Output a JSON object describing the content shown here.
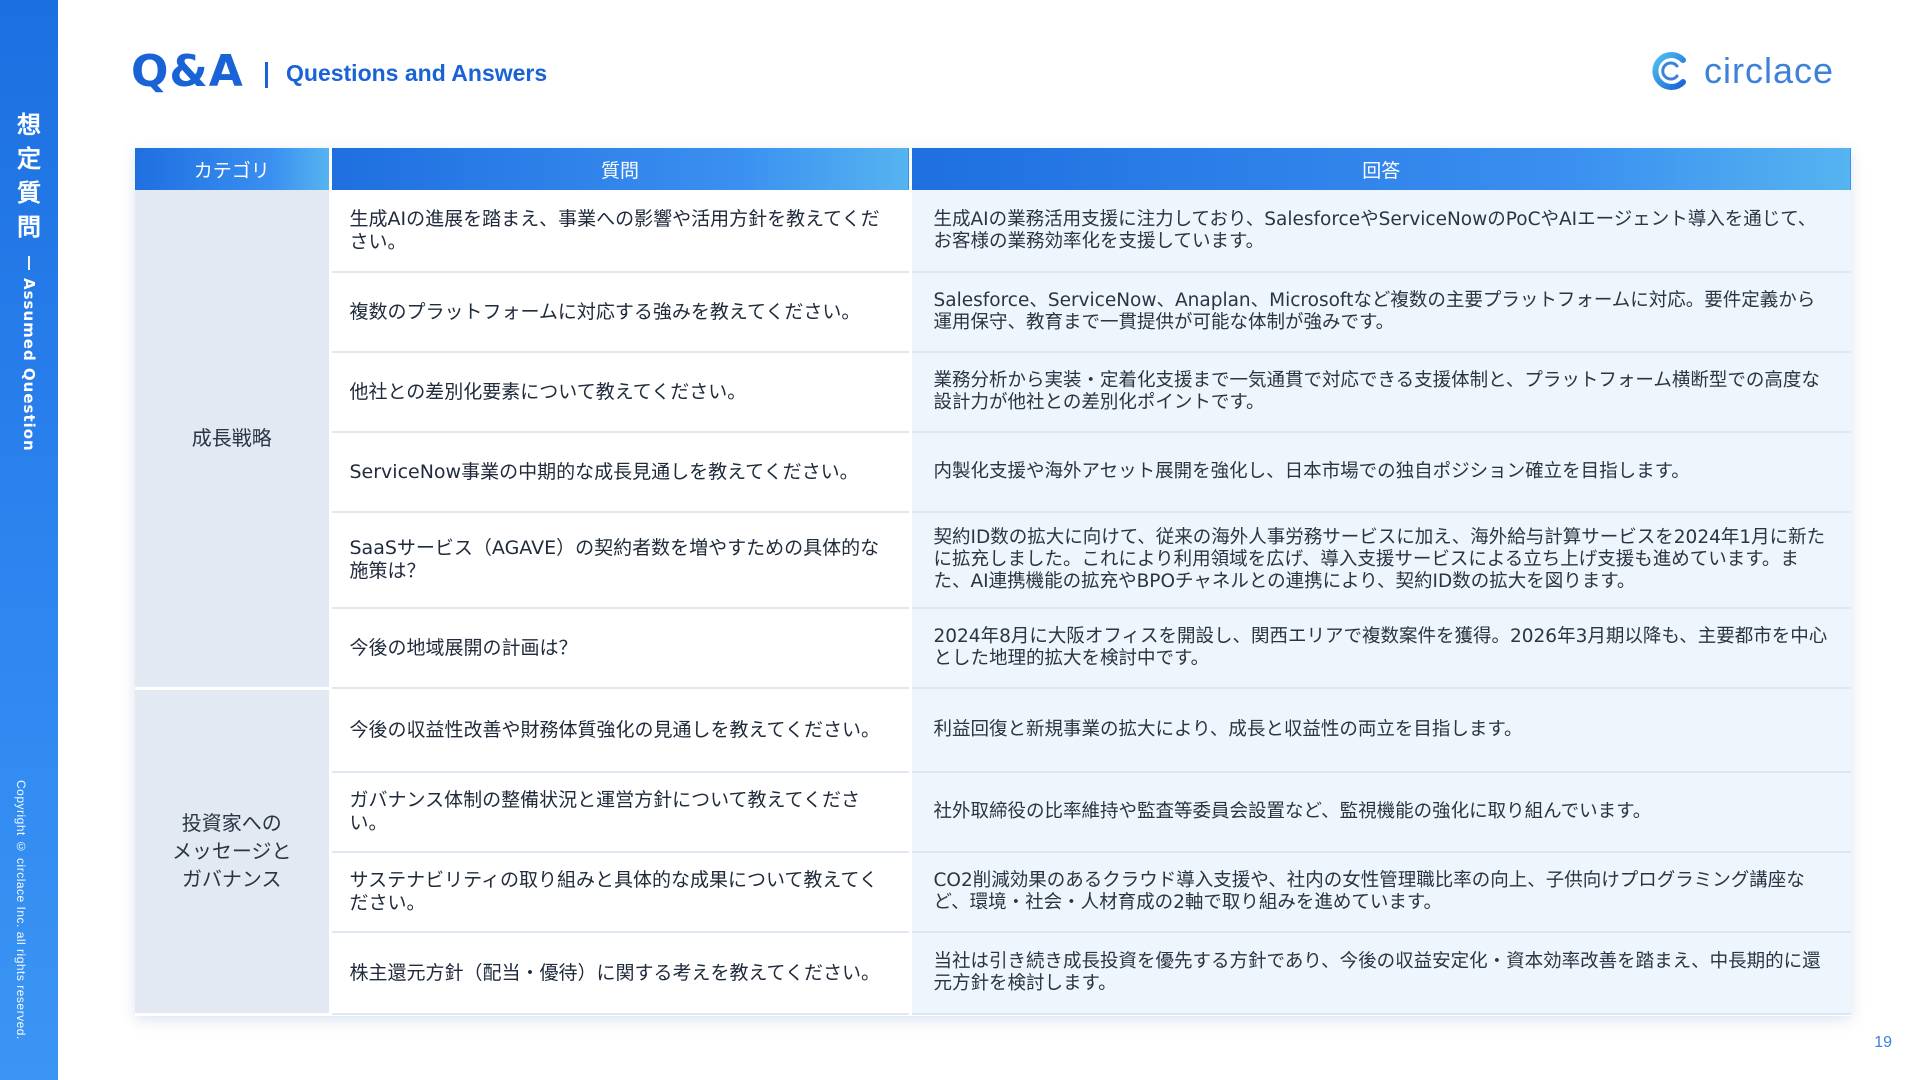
{
  "sidebar": {
    "title_chars": [
      "想",
      "定",
      "質",
      "問"
    ],
    "subtitle": "Assumed Question",
    "copyright": "Copyright © circlace Inc. all rights reserved."
  },
  "header": {
    "title": "Q&A",
    "subtitle": "Questions and Answers",
    "logo_text": "circlace"
  },
  "table": {
    "headers": [
      "カテゴリ",
      "質問",
      "回答"
    ],
    "groups": [
      {
        "category": "成長戦略",
        "rows": [
          {
            "question": "生成AIの進展を踏まえ、事業への影響や活用方針を教えてください。",
            "answer": "生成AIの業務活用支援に注力しており、SalesforceやServiceNowのPoCやAIエージェント導入を通じて、お客様の業務効率化を支援しています。"
          },
          {
            "question": "複数のプラットフォームに対応する強みを教えてください。",
            "answer": "Salesforce、ServiceNow、Anaplan、Microsoftなど複数の主要プラットフォームに対応。要件定義から運用保守、教育まで一貫提供が可能な体制が強みです。"
          },
          {
            "question": "他社との差別化要素について教えてください。",
            "answer": "業務分析から実装・定着化支援まで一気通貫で対応できる支援体制と、プラットフォーム横断型での高度な設計力が他社との差別化ポイントです。"
          },
          {
            "question": "ServiceNow事業の中期的な成長見通しを教えてください。",
            "answer": "内製化支援や海外アセット展開を強化し、日本市場での独自ポジション確立を目指します。"
          },
          {
            "question": "SaaSサービス（AGAVE）の契約者数を増やすための具体的な施策は？",
            "answer": "契約ID数の拡大に向けて、従来の海外人事労務サービスに加え、海外給与計算サービスを2024年1月に新たに拡充しました。これにより利用領域を広げ、導入支援サービスによる立ち上げ支援も進めています。また、AI連携機能の拡充やBPOチャネルとの連携により、契約ID数の拡大を図ります。"
          },
          {
            "question": "今後の地域展開の計画は？",
            "answer": "2024年8月に大阪オフィスを開設し、関西エリアで複数案件を獲得。2026年3月期以降も、主要都市を中心とした地理的拡大を検討中です。"
          }
        ]
      },
      {
        "category": "投資家への\nメッセージと\nガバナンス",
        "rows": [
          {
            "question": "今後の収益性改善や財務体質強化の見通しを教えてください。",
            "answer": "利益回復と新規事業の拡大により、成長と収益性の両立を目指します。"
          },
          {
            "question": "ガバナンス体制の整備状況と運営方針について教えてください。",
            "answer": "社外取締役の比率維持や監査等委員会設置など、監視機能の強化に取り組んでいます。"
          },
          {
            "question": "サステナビリティの取り組みと具体的な成果について教えてください。",
            "answer": "CO2削減効果のあるクラウド導入支援や、社内の女性管理職比率の向上、子供向けプログラミング講座など、環境・社会・人材育成の2軸で取り組みを進めています。"
          },
          {
            "question": "株主還元方針（配当・優待）に関する考えを教えてください。",
            "answer": "当社は引き続き成長投資を優先する方針であり、今後の収益安定化・資本効率改善を踏まえ、中長期的に還元方針を検討します。"
          }
        ]
      }
    ]
  },
  "footer": {
    "page_number": "19"
  },
  "colors": {
    "brand_blue": "#1a63d6",
    "header_gradient_start": "#1f6fe0",
    "header_gradient_end": "#56b4f0",
    "category_bg": "#e2e9f2",
    "answer_bg": "#eef5fd"
  }
}
